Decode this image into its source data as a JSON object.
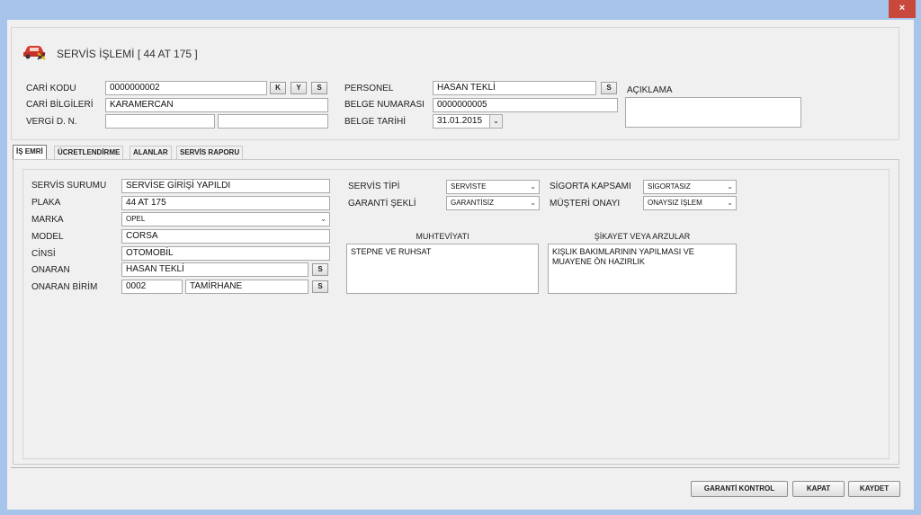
{
  "window": {
    "close_label": "×"
  },
  "title": "SERVİS İŞLEMİ [ 44 AT 175 ]",
  "header": {
    "cari_kodu_label": "CARİ KODU",
    "cari_kodu_value": "0000000002",
    "cari_bilgileri_label": "CARİ BİLGİLERİ",
    "cari_bilgileri_value": "KARAMERCAN",
    "vergi_label": "VERGİ D. N.",
    "vergi_daire_value": "",
    "vergi_no_value": "",
    "btn_k": "K",
    "btn_y": "Y",
    "btn_s": "S",
    "personel_label": "PERSONEL",
    "personel_value": "HASAN TEKLİ",
    "belge_no_label": "BELGE NUMARASI",
    "belge_no_value": "0000000005",
    "belge_tarihi_label": "BELGE TARİHİ",
    "belge_tarihi_value": "31.01.2015",
    "aciklama_label": "AÇIKLAMA",
    "aciklama_value": ""
  },
  "tabs": [
    {
      "label": "İŞ EMRİ",
      "active": true
    },
    {
      "label": "ÜCRETLENDİRME",
      "active": false
    },
    {
      "label": "ALANLAR",
      "active": false
    },
    {
      "label": "SERVİS RAPORU",
      "active": false
    }
  ],
  "is_emri": {
    "servis_surumu_label": "SERVİS SURUMU",
    "servis_surumu_value": "SERVİSE GİRİŞİ YAPILDI",
    "plaka_label": "PLAKA",
    "plaka_value": "44 AT 175",
    "marka_label": "MARKA",
    "marka_value": "OPEL",
    "model_label": "MODEL",
    "model_value": "CORSA",
    "cinsi_label": "CİNSİ",
    "cinsi_value": "OTOMOBİL",
    "onaran_label": "ONARAN",
    "onaran_value": "HASAN TEKLİ",
    "onaran_birim_label": "ONARAN BİRİM",
    "onaran_birim_code": "0002",
    "onaran_birim_name": "TAMİRHANE",
    "btn_s": "S",
    "servis_tipi_label": "SERVİS TİPİ",
    "servis_tipi_value": "SERVİSTE",
    "garanti_sekli_label": "GARANTİ ŞEKLİ",
    "garanti_sekli_value": "GARANTİSİZ",
    "sigorta_kapsami_label": "SİGORTA KAPSAMI",
    "sigorta_kapsami_value": "SİGORTASIZ",
    "musteri_onayi_label": "MÜŞTERİ ONAYI",
    "musteri_onayi_value": "ONAYSIZ İŞLEM",
    "muhteviyati_label": "MUHTEVİYATI",
    "muhteviyati_value": "STEPNE VE RUHSAT",
    "sikayet_label": "ŞİKAYET VEYA ARZULAR",
    "sikayet_value": "KIŞLIK BAKIMLARININ YAPILMASI VE MUAYENE ÖN HAZIRLIK"
  },
  "footer": {
    "garanti_kontrol": "GARANTİ KONTROL",
    "kapat": "KAPAT",
    "kaydet": "KAYDET"
  },
  "colors": {
    "title_bar": "#a7c4ea",
    "close_button": "#c9483c",
    "car_icon": "#d33a2c"
  },
  "icons": {
    "form_icon": "car-repair-icon"
  }
}
